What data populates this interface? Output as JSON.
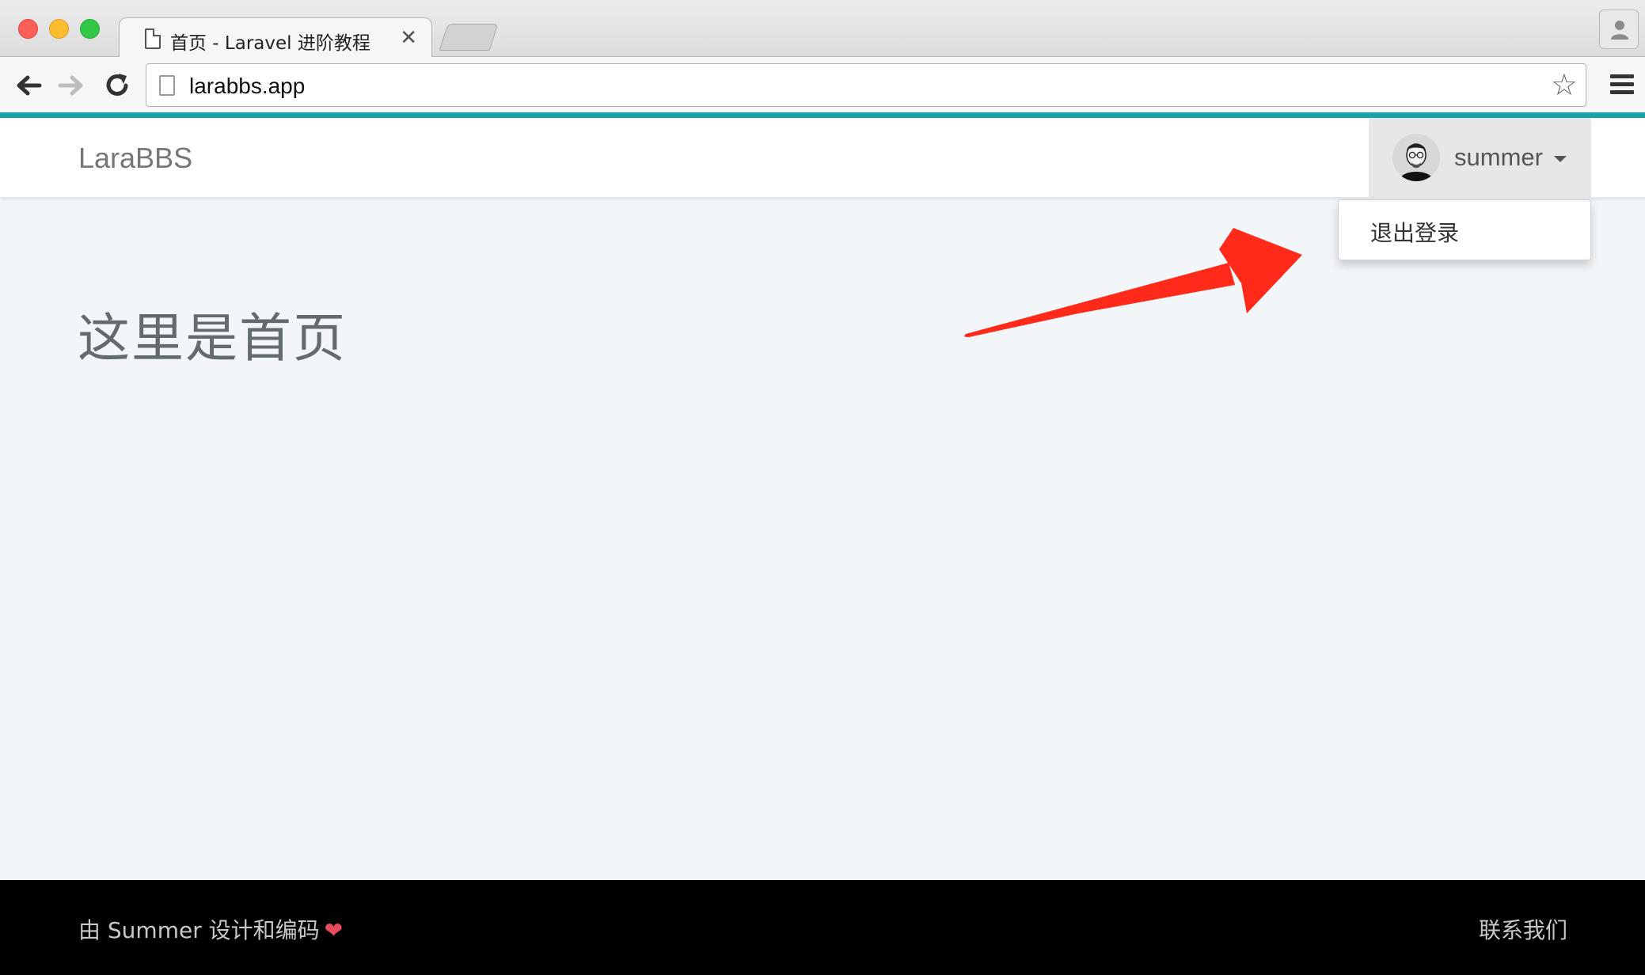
{
  "browser": {
    "tab": {
      "title": "首页 - Laravel 进阶教程",
      "close_glyph": "✕"
    },
    "url": "larabbs.app",
    "bookmark_glyph": "☆"
  },
  "navbar": {
    "brand": "LaraBBS",
    "user": {
      "name": "summer"
    },
    "dropdown": {
      "items": [
        {
          "label": "退出登录"
        }
      ]
    }
  },
  "main": {
    "heading": "这里是首页"
  },
  "footer": {
    "left_text": "由 Summer 设计和编码",
    "heart_glyph": "❤",
    "right_link": "联系我们"
  },
  "colors": {
    "accent": "#15a3a7",
    "page_bg": "#f3f6f9",
    "footer_bg": "#000000",
    "annotation_arrow": "#ff2a1a",
    "heart": "#e74c5e"
  },
  "icons": [
    "file-icon",
    "back-arrow-icon",
    "forward-arrow-icon",
    "reload-icon",
    "star-icon",
    "hamburger-menu-icon",
    "profile-icon",
    "caret-down-icon",
    "heart-icon",
    "annotation-arrow"
  ]
}
